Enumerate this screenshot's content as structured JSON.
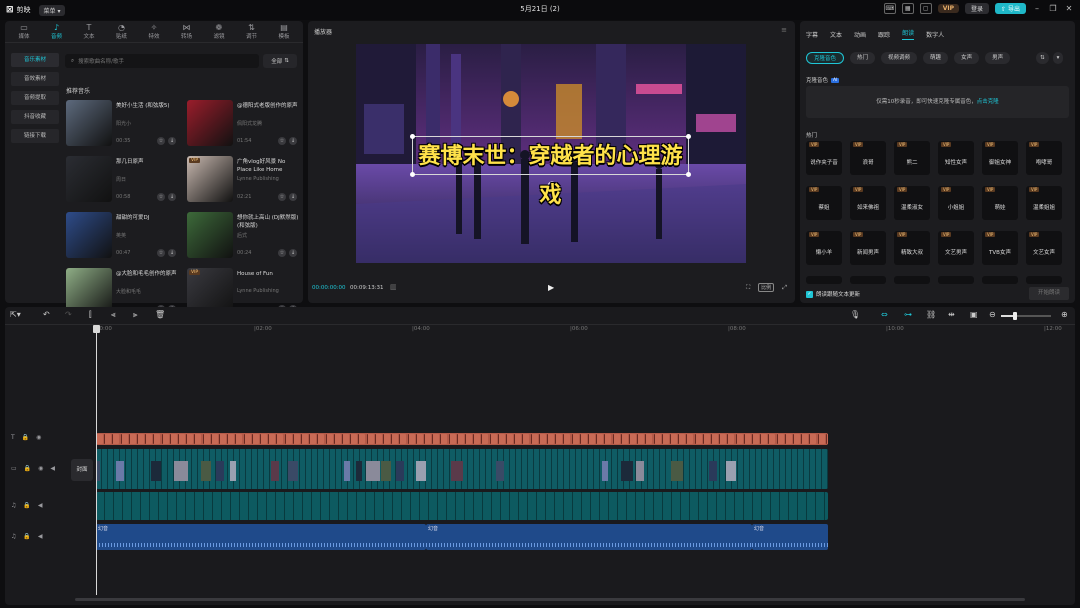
{
  "titlebar": {
    "app_name": "剪映",
    "menu_label": "菜单",
    "title": "5月21日 (2)",
    "vip": "VIP",
    "login": "登录",
    "export": "导出"
  },
  "media_tools": [
    {
      "icon": "media-icon",
      "glyph": "▭",
      "label": "媒体"
    },
    {
      "icon": "audio-icon",
      "glyph": "♪",
      "label": "音频"
    },
    {
      "icon": "text-icon",
      "glyph": "T",
      "label": "文本"
    },
    {
      "icon": "sticker-icon",
      "glyph": "◔",
      "label": "贴纸"
    },
    {
      "icon": "effects-icon",
      "glyph": "✧",
      "label": "特效"
    },
    {
      "icon": "transition-icon",
      "glyph": "⋈",
      "label": "转场"
    },
    {
      "icon": "filter-icon",
      "glyph": "❁",
      "label": "滤镜"
    },
    {
      "icon": "adjust-icon",
      "glyph": "⇅",
      "label": "调节"
    },
    {
      "icon": "template-icon",
      "glyph": "▤",
      "label": "模板"
    }
  ],
  "audio_categories": [
    "音乐素材",
    "音效素材",
    "音频提取",
    "抖音收藏",
    "链接下载"
  ],
  "search": {
    "placeholder": "搜索歌曲名称/歌手",
    "filter_label": "全部"
  },
  "section_title": "推荐音乐",
  "tracks": [
    {
      "title": "美好小生活 (和弦版5)",
      "artist": "阳光小",
      "duration": "00:35",
      "vip": false,
      "thumb": "#5d6a7d"
    },
    {
      "title": "@德阳式老版创作的原声",
      "artist": "佩阳式龙腾",
      "duration": "01:54",
      "vip": false,
      "thumb": "#9a1d2b"
    },
    {
      "title": "那几日原声",
      "artist": "周日",
      "duration": "00:58",
      "vip": false,
      "thumb": "#2b2d33"
    },
    {
      "title": "广角vlog好风景 No Place Like Home",
      "artist": "Lynne Publishing",
      "duration": "02:21",
      "vip": true,
      "thumb": "#c9b9b0"
    },
    {
      "title": "甜甜的可爱DJ",
      "artist": "英英",
      "duration": "00:47",
      "vip": false,
      "thumb": "#2e4c8a"
    },
    {
      "title": "想你就上高山 (DJ默然版) (和弦版)",
      "artist": "后式",
      "duration": "00:24",
      "vip": false,
      "thumb": "#3d6a3a"
    },
    {
      "title": "@大脸和毛毛创作的原声",
      "artist": "大脸和毛毛",
      "duration": "",
      "vip": false,
      "thumb": "#8fae86"
    },
    {
      "title": "House of Fun",
      "artist": "Lynne Publishing",
      "duration": "",
      "vip": true,
      "thumb": "#3a3a40"
    }
  ],
  "player": {
    "title": "播放器",
    "caption": "赛博末世：穿越者的心理游戏",
    "time_current": "00:00:00:00",
    "time_total": "00:09:13:31",
    "ratio_label": "比例"
  },
  "right_panel": {
    "tabs": [
      "字幕",
      "文本",
      "动画",
      "跟踪",
      "朗读",
      "数字人"
    ],
    "active_tab": 4,
    "chips": [
      "克隆音色",
      "热门",
      "视频调频",
      "萌趣",
      "女声",
      "男声"
    ],
    "clone_title": "克隆音色",
    "ai_tag": "AI",
    "clone_hint": "仅需10秒录音，即可快速克隆专属音色，",
    "clone_link": "点击克隆",
    "hot_title": "热门",
    "voices": [
      "说作夹子音",
      "浪哥",
      "熊二",
      "知性女声",
      "御姐女神",
      "咆哮哥",
      "蔡姐",
      "如来佛祖",
      "温柔淑女",
      "小姐姐",
      "萌娃",
      "温柔姐姐",
      "懒小羊",
      "新闻男声",
      "精致大叔",
      "文艺男声",
      "TVB女声",
      "文艺女声"
    ],
    "sync_label": "朗读跟随文本更新",
    "start_label": "开始朗读"
  },
  "timeline": {
    "ruler": [
      "00:00",
      "|02:00",
      "|04:00",
      "|06:00",
      "|08:00",
      "|10:00",
      "|12:00"
    ],
    "cover_label": "封面",
    "audio_clips": [
      {
        "name": "幻音"
      },
      {
        "name": "幻音"
      },
      {
        "name": "幻音"
      }
    ]
  },
  "colors": {
    "accent": "#1fc6d6",
    "subtitle_clip": "#b45a48",
    "video_clip": "#0f5c64",
    "audio_clip": "#1f4a8a"
  }
}
